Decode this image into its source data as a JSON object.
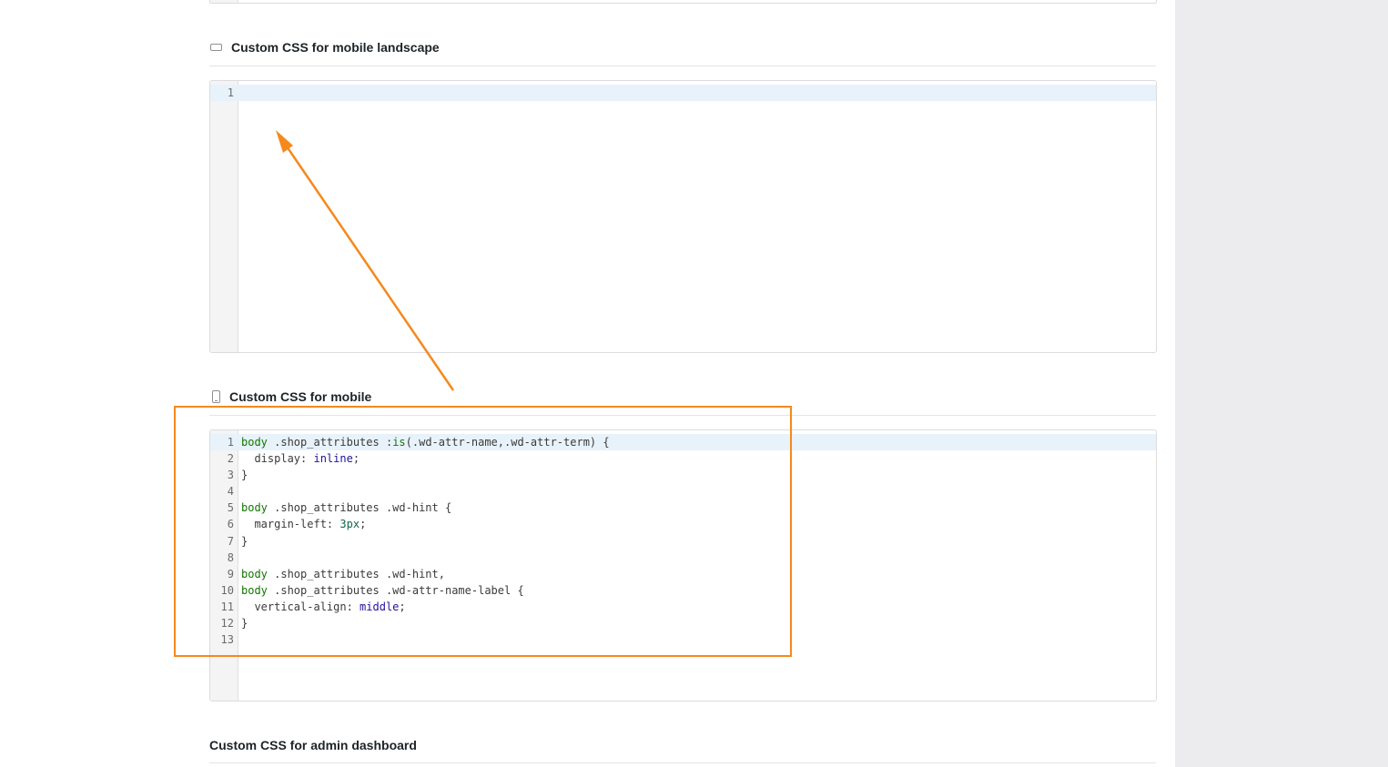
{
  "sections": {
    "landscape": {
      "title": "Custom CSS for mobile landscape",
      "icon": "mobile-landscape-icon"
    },
    "mobile": {
      "title": "Custom CSS for mobile",
      "icon": "mobile-portrait-icon"
    },
    "admin": {
      "title": "Custom CSS for admin dashboard"
    }
  },
  "landscape_editor": {
    "lines": [
      {
        "num": "1",
        "text": ""
      }
    ]
  },
  "mobile_editor": {
    "lines": [
      {
        "num": "1",
        "tokens": [
          [
            "tag",
            "body"
          ],
          [
            "sel",
            " .shop_attributes "
          ],
          [
            "sel",
            ":"
          ],
          [
            "kw",
            "is"
          ],
          [
            "sel",
            "(.wd-attr-name,.wd-attr-term) {"
          ]
        ]
      },
      {
        "num": "2",
        "tokens": [
          [
            "sel",
            "  display: "
          ],
          [
            "val",
            "inline"
          ],
          [
            "sel",
            ";"
          ]
        ]
      },
      {
        "num": "3",
        "tokens": [
          [
            "sel",
            "}"
          ]
        ]
      },
      {
        "num": "4",
        "tokens": []
      },
      {
        "num": "5",
        "tokens": [
          [
            "tag",
            "body"
          ],
          [
            "sel",
            " .shop_attributes .wd-hint {"
          ]
        ]
      },
      {
        "num": "6",
        "tokens": [
          [
            "sel",
            "  margin-left: "
          ],
          [
            "num",
            "3px"
          ],
          [
            "sel",
            ";"
          ]
        ]
      },
      {
        "num": "7",
        "tokens": [
          [
            "sel",
            "}"
          ]
        ]
      },
      {
        "num": "8",
        "tokens": []
      },
      {
        "num": "9",
        "tokens": [
          [
            "tag",
            "body"
          ],
          [
            "sel",
            " .shop_attributes .wd-hint,"
          ]
        ]
      },
      {
        "num": "10",
        "tokens": [
          [
            "tag",
            "body"
          ],
          [
            "sel",
            " .shop_attributes .wd-attr-name-label {"
          ]
        ]
      },
      {
        "num": "11",
        "tokens": [
          [
            "sel",
            "  vertical-align: "
          ],
          [
            "val",
            "middle"
          ],
          [
            "sel",
            ";"
          ]
        ]
      },
      {
        "num": "12",
        "tokens": [
          [
            "sel",
            "}"
          ]
        ]
      },
      {
        "num": "13",
        "tokens": []
      }
    ]
  },
  "colors": {
    "annotation": "#f5891d",
    "active_line": "#e8f2fb",
    "side_panel": "#ececee"
  }
}
